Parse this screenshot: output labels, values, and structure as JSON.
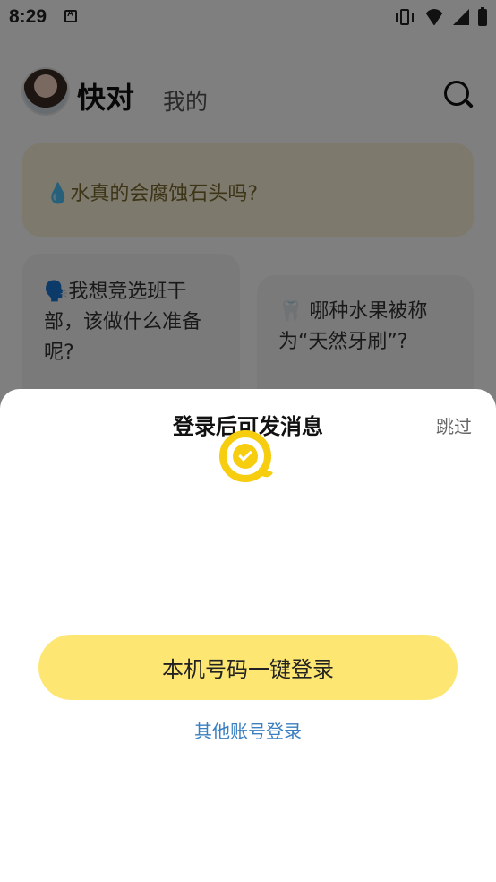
{
  "status_bar": {
    "time": "8:29",
    "icons": [
      "app-notification-icon",
      "vibrate-icon",
      "wifi-icon",
      "signal-icon",
      "battery-icon"
    ]
  },
  "header": {
    "tabs": [
      {
        "label": "快对",
        "active": true
      },
      {
        "label": "我的",
        "active": false
      }
    ],
    "search_icon": "search-icon"
  },
  "feed": {
    "cards": [
      {
        "emoji": "💧",
        "text": "水真的会腐蚀石头吗?"
      },
      {
        "emoji": "🗣️",
        "text": "我想竞选班干部，该做什么准备呢?"
      },
      {
        "emoji": "🦷",
        "text": " 哪种水果被称为“天然牙刷”?"
      }
    ]
  },
  "login_sheet": {
    "title": "登录后可发消息",
    "skip_label": "跳过",
    "logo_icon": "kuaidui-logo-icon",
    "one_click_login_label": "本机号码一键登录",
    "other_login_label": "其他账号登录",
    "colors": {
      "accent_yellow": "#fde772",
      "logo_yellow": "#f7cd10",
      "link_blue": "#3a7fc1"
    }
  }
}
